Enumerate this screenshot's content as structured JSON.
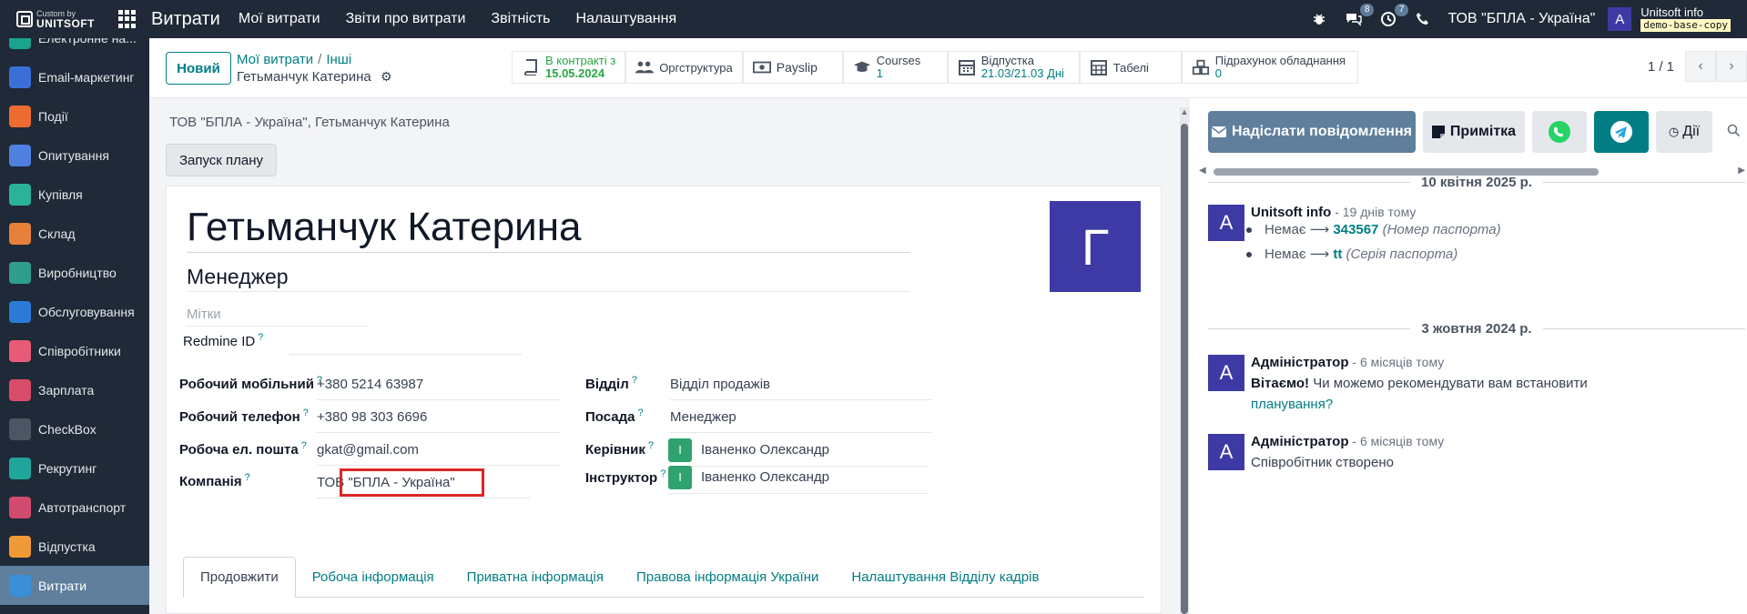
{
  "topbar": {
    "brand_small": "Custom by",
    "brand_big": "UNITSOFT",
    "app_name": "Витрати",
    "menu": [
      "Мої витрати",
      "Звіти про витрати",
      "Звітність",
      "Налаштування"
    ],
    "chat_badge": "8",
    "activity_badge": "7",
    "company": "ТОВ \"БПЛА - Україна\"",
    "avatar_letter": "A",
    "user_name": "Unitsoft info",
    "db_name": "demo-base-copy"
  },
  "sidebar": {
    "items": [
      {
        "label": "Електронне на...",
        "color": "#1aa38f"
      },
      {
        "label": "Email-маркетинг",
        "color": "#3b6fd8"
      },
      {
        "label": "Події",
        "color": "#ee6b2f"
      },
      {
        "label": "Опитування",
        "color": "#4f7fe0"
      },
      {
        "label": "Купівля",
        "color": "#2bb39a"
      },
      {
        "label": "Склад",
        "color": "#e7813a"
      },
      {
        "label": "Виробництво",
        "color": "#2f9e8c"
      },
      {
        "label": "Обслуговування",
        "color": "#2d7bd8"
      },
      {
        "label": "Співробітники",
        "color": "#e85a77"
      },
      {
        "label": "Зарплата",
        "color": "#d94d6a"
      },
      {
        "label": "CheckBox",
        "color": "#4b5563"
      },
      {
        "label": "Рекрутинг",
        "color": "#1fa59a"
      },
      {
        "label": "Автотранспорт",
        "color": "#d24a6e"
      },
      {
        "label": "Відпустка",
        "color": "#f09a35"
      },
      {
        "label": "Витрати",
        "color": "#3a8fd9"
      }
    ]
  },
  "control_panel": {
    "new_label": "Новий",
    "crumb1": "Мої витрати",
    "crumb2": "Інші",
    "current": "Гетьманчук Катерина",
    "pager": "1 / 1"
  },
  "smart_buttons": {
    "contract_l1": "В контракті з",
    "contract_l2": "15.05.2024",
    "org": "Оргструктура",
    "payslip": "Payslip",
    "courses_l1": "Courses",
    "courses_l2": "1",
    "leave_l1": "Відпустка",
    "leave_l2": "21.03/21.03 Дні",
    "timesheets": "Табелі",
    "equipment_l1": "Підрахунок обладнання",
    "equipment_l2": "0"
  },
  "form": {
    "company_line": "ТОВ \"БПЛА - Україна\", Гетьманчук Катерина",
    "start_plan": "Запуск плану",
    "name": "Гетьманчук Катерина",
    "job_title": "Менеджер",
    "tags_placeholder": "Мітки",
    "redmine_label": "Redmine ID",
    "avatar_letter": "Г",
    "help": "?",
    "work_mobile_label": "Робочий мобільний",
    "work_mobile": "+380 5214 63987",
    "work_phone_label": "Робочий телефон",
    "work_phone": "+380 98 303 6696",
    "work_email_label": "Робоча ел. пошта",
    "work_email": "gkat@gmail.com",
    "company_label": "Компанія",
    "company": "ТОВ \"БПЛА - Україна\"",
    "department_label": "Відділ",
    "department": "Відділ продажів",
    "position_label": "Посада",
    "position": "Менеджер",
    "manager_label": "Керівник",
    "manager": "Іваненко Олександр",
    "coach_label": "Інструктор",
    "coach": "Іваненко Олександр",
    "person_initial": "І",
    "tabs": [
      "Продовжити",
      "Робоча інформація",
      "Приватна інформація",
      "Правова інформація України",
      "Налаштування Відділу кадрів"
    ]
  },
  "chatter": {
    "send_label": "Надіслати повідомлення",
    "note_label": "Примітка",
    "actions_label": "Дії",
    "date1": "10 квітня 2025 р.",
    "msg1_author": "Unitsoft info",
    "msg1_time": " - 19 днів тому",
    "msg1_avatar": "A",
    "change1_old": "Немає",
    "change1_new": "343567",
    "change1_field": "(Номер паспорта)",
    "change2_old": "Немає",
    "change2_new": "tt",
    "change2_field": "(Серія паспорта)",
    "date2": "3 жовтня 2024 р.",
    "msg2_author": "Адміністратор",
    "msg2_time": " - 6 місяців тому",
    "msg2_bold": "Вітаємо!",
    "msg2_text": " Чи можемо рекомендувати вам встановити",
    "msg2_link": "планування?",
    "msg3_author": "Адміністратор",
    "msg3_time": " - 6 місяців тому",
    "msg3_text": "Співробітник створено"
  }
}
